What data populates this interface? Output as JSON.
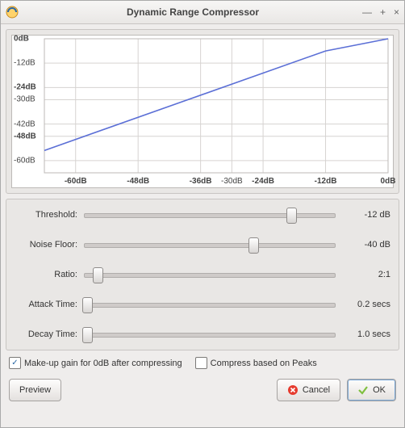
{
  "window": {
    "title": "Dynamic Range Compressor",
    "controls": {
      "minimize": "—",
      "maximize": "+",
      "close": "×"
    }
  },
  "chart_data": {
    "type": "line",
    "title": "",
    "xlabel": "",
    "ylabel": "",
    "xlim": [
      -66,
      0
    ],
    "ylim": [
      -66,
      0
    ],
    "x_ticks": [
      {
        "v": -60,
        "l": "-60dB",
        "b": true
      },
      {
        "v": -48,
        "l": "-48dB",
        "b": true
      },
      {
        "v": -36,
        "l": "-36dB",
        "b": true
      },
      {
        "v": -30,
        "l": "-30dB",
        "b": false
      },
      {
        "v": -24,
        "l": "-24dB",
        "b": true
      },
      {
        "v": -12,
        "l": "-12dB",
        "b": true
      },
      {
        "v": 0,
        "l": "0dB",
        "b": true
      }
    ],
    "y_ticks": [
      {
        "v": 0,
        "l": "0dB",
        "b": true
      },
      {
        "v": -12,
        "l": "-12dB",
        "b": false
      },
      {
        "v": -24,
        "l": "-24dB",
        "b": true
      },
      {
        "v": -30,
        "l": "-30dB",
        "b": false
      },
      {
        "v": -42,
        "l": "-42dB",
        "b": false
      },
      {
        "v": -48,
        "l": "-48dB",
        "b": true
      },
      {
        "v": -60,
        "l": "-60dB",
        "b": false
      }
    ],
    "series": [
      {
        "name": "transfer",
        "values": [
          {
            "x": -66,
            "y": -55
          },
          {
            "x": -12,
            "y": -6
          },
          {
            "x": 0,
            "y": 0
          }
        ]
      }
    ]
  },
  "sliders": {
    "threshold": {
      "label": "Threshold:",
      "value": "-12 dB",
      "pos": 82
    },
    "noise_floor": {
      "label": "Noise Floor:",
      "value": "-40 dB",
      "pos": 67
    },
    "ratio": {
      "label": "Ratio:",
      "value": "2:1",
      "pos": 6
    },
    "attack": {
      "label": "Attack Time:",
      "value": "0.2 secs",
      "pos": 2
    },
    "decay": {
      "label": "Decay Time:",
      "value": "1.0 secs",
      "pos": 2
    }
  },
  "checkboxes": {
    "makeup": {
      "label": "Make-up gain for 0dB after compressing",
      "checked": true
    },
    "peaks": {
      "label": "Compress based on Peaks",
      "checked": false
    }
  },
  "buttons": {
    "preview": "Preview",
    "cancel": "Cancel",
    "ok": "OK"
  }
}
